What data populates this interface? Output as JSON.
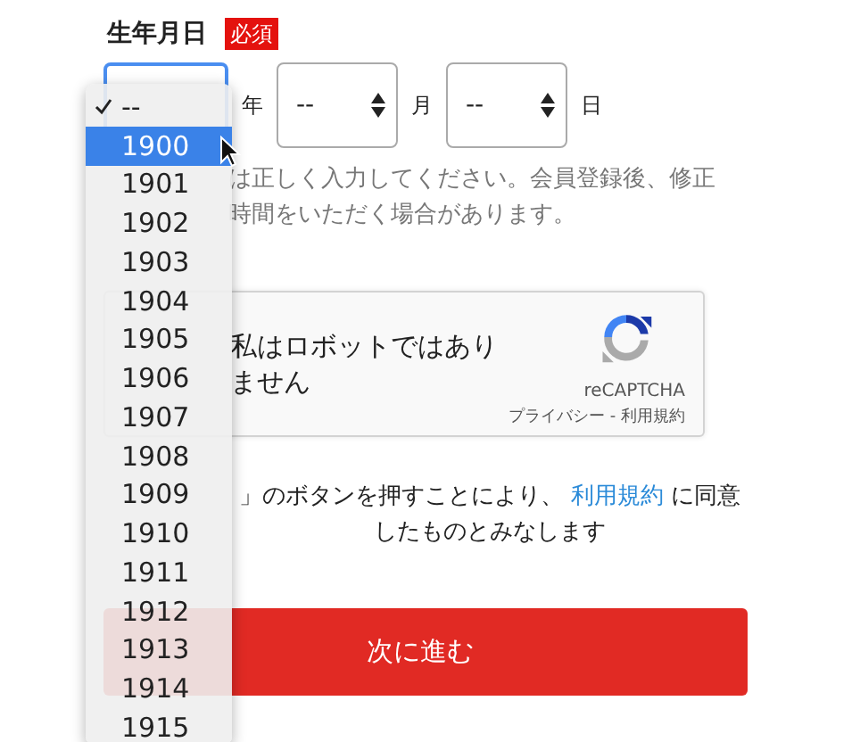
{
  "field": {
    "label": "生年月日",
    "badge": "必須"
  },
  "selects": [
    {
      "kind": "year",
      "unit": "年",
      "focused": true
    },
    {
      "kind": "month",
      "value": "--",
      "unit": "月",
      "focused": false
    },
    {
      "kind": "day",
      "value": "--",
      "unit": "日",
      "focused": false
    }
  ],
  "note": {
    "lines": [
      "は正しく入力してください。会員登録後、修正",
      "時間をいただく場合があります。"
    ]
  },
  "captcha": {
    "label_lines": [
      "私はロボットではあり",
      "ません"
    ],
    "brand": "reCAPTCHA",
    "links": "プライバシー - 利用規約"
  },
  "consent": {
    "before": "」のボタンを押すことにより、",
    "link": "利用規約",
    "after": "に同意",
    "line2": "したものとみなします"
  },
  "submit": {
    "label": "次に進む"
  },
  "dropdown": {
    "options": [
      {
        "label": "--",
        "checked": true,
        "selected": false
      },
      {
        "label": "1900",
        "checked": false,
        "selected": true
      },
      {
        "label": "1901",
        "checked": false,
        "selected": false
      },
      {
        "label": "1902",
        "checked": false,
        "selected": false
      },
      {
        "label": "1903",
        "checked": false,
        "selected": false
      },
      {
        "label": "1904",
        "checked": false,
        "selected": false
      },
      {
        "label": "1905",
        "checked": false,
        "selected": false
      },
      {
        "label": "1906",
        "checked": false,
        "selected": false
      },
      {
        "label": "1907",
        "checked": false,
        "selected": false
      },
      {
        "label": "1908",
        "checked": false,
        "selected": false
      },
      {
        "label": "1909",
        "checked": false,
        "selected": false
      },
      {
        "label": "1910",
        "checked": false,
        "selected": false
      },
      {
        "label": "1911",
        "checked": false,
        "selected": false
      },
      {
        "label": "1912",
        "checked": false,
        "selected": false
      },
      {
        "label": "1913",
        "checked": false,
        "selected": false
      },
      {
        "label": "1914",
        "checked": false,
        "selected": false
      },
      {
        "label": "1915",
        "checked": false,
        "selected": false
      }
    ]
  }
}
